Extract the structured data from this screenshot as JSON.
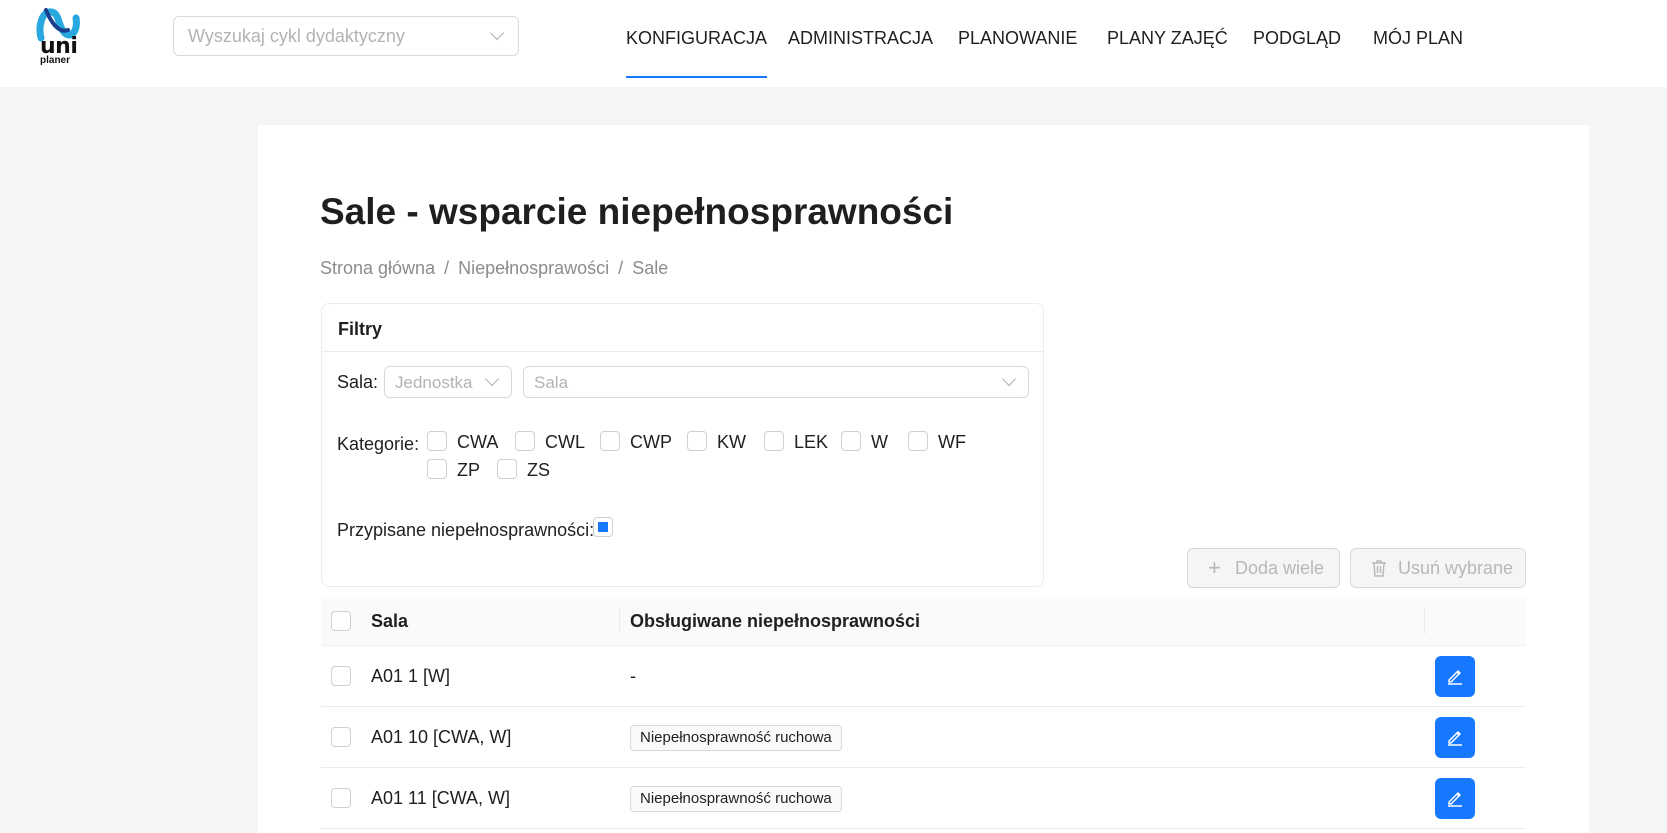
{
  "header": {
    "logo": {
      "line1": "uni",
      "line2": "planer"
    },
    "cycle_search": {
      "placeholder": "Wyszukaj cykl dydaktyczny"
    },
    "nav": [
      {
        "label": "KONFIGURACJA",
        "active": true
      },
      {
        "label": "ADMINISTRACJA",
        "active": false
      },
      {
        "label": "PLANOWANIE",
        "active": false
      },
      {
        "label": "PLANY ZAJĘĆ",
        "active": false
      },
      {
        "label": "PODGLĄD",
        "active": false
      },
      {
        "label": "MÓJ PLAN",
        "active": false
      }
    ],
    "accent_color": "#1677ff"
  },
  "page": {
    "title": "Sale - wsparcie niepełnosprawności",
    "breadcrumb": [
      "Strona główna",
      "Niepełnosprawości",
      "Sale"
    ]
  },
  "filters": {
    "title": "Filtry",
    "room_label": "Sala",
    "unit_placeholder": "Jednostka",
    "room_placeholder": "Sala",
    "categories_label": "Kategorie",
    "categories": [
      {
        "label": "CWA",
        "checked": false
      },
      {
        "label": "CWL",
        "checked": false
      },
      {
        "label": "CWP",
        "checked": false
      },
      {
        "label": "KW",
        "checked": false
      },
      {
        "label": "LEK",
        "checked": false
      },
      {
        "label": "W",
        "checked": false
      },
      {
        "label": "WF",
        "checked": false
      },
      {
        "label": "ZP",
        "checked": false
      },
      {
        "label": "ZS",
        "checked": false
      }
    ],
    "assigned_label": "Przypisane niepełnosprawności",
    "assigned_state": "indeterminate"
  },
  "actions": {
    "add_many": "Doda wiele",
    "delete_selected": "Usuń wybrane"
  },
  "table": {
    "columns": [
      "Sala",
      "Obsługiwane niepełnosprawności"
    ],
    "rows": [
      {
        "room": "A01 1 [W]",
        "disabilities": "-",
        "tag": false
      },
      {
        "room": "A01 10 [CWA, W]",
        "disabilities": "Niepełnosprawność ruchowa",
        "tag": true
      },
      {
        "room": "A01 11 [CWA, W]",
        "disabilities": "Niepełnosprawność ruchowa",
        "tag": true
      }
    ]
  }
}
